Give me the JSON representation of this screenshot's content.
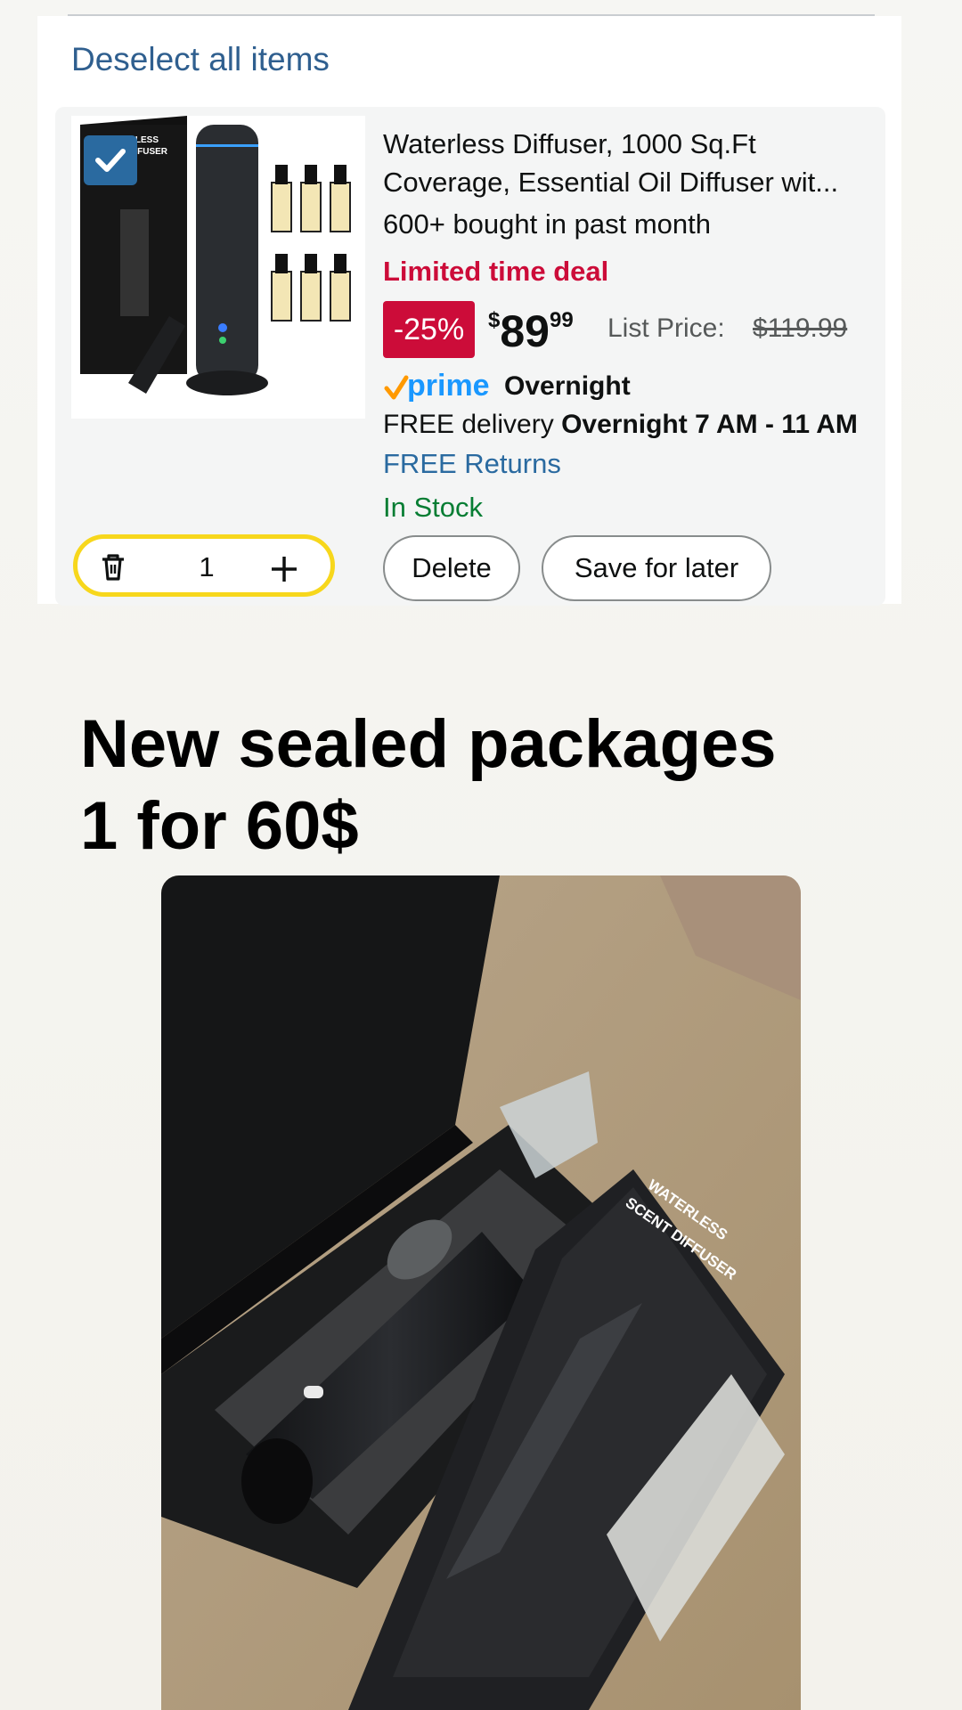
{
  "cart": {
    "deselect_label": "Deselect all items",
    "item": {
      "image_text": [
        "ERLESS",
        "DIFFUSER"
      ],
      "title": "Waterless Diffuser, 1000 Sq.Ft\nCoverage, Essential Oil Diffuser wit...",
      "bought": "600+ bought in past month",
      "deal_label": "Limited time deal",
      "discount": "-25%",
      "price_currency": "$",
      "price_whole": "89",
      "price_fraction": "99",
      "list_price_label": "List Price:",
      "list_price_value": "$119.99",
      "prime_logo": "prime",
      "prime_speed": "Overnight",
      "delivery_prefix": "FREE delivery",
      "delivery_window": "Overnight 7 AM - 11 AM",
      "returns": "FREE Returns",
      "stock": "In Stock",
      "quantity": "1",
      "delete_label": "Delete",
      "save_label": "Save for later"
    }
  },
  "post": {
    "headline_line1": "New sealed packages",
    "headline_line2": "1 for 60$",
    "photo_box_text": [
      "WATERLESS",
      "SCENT DIFFUSER"
    ]
  },
  "colors": {
    "link_blue": "#2a6aa0",
    "deal_red": "#cc0c39",
    "stock_green": "#067d33",
    "qty_outline": "#f7d71c",
    "prime_blue": "#1a98ff"
  },
  "icons": [
    "check-icon",
    "trash-icon",
    "plus-icon",
    "prime-check-icon"
  ]
}
